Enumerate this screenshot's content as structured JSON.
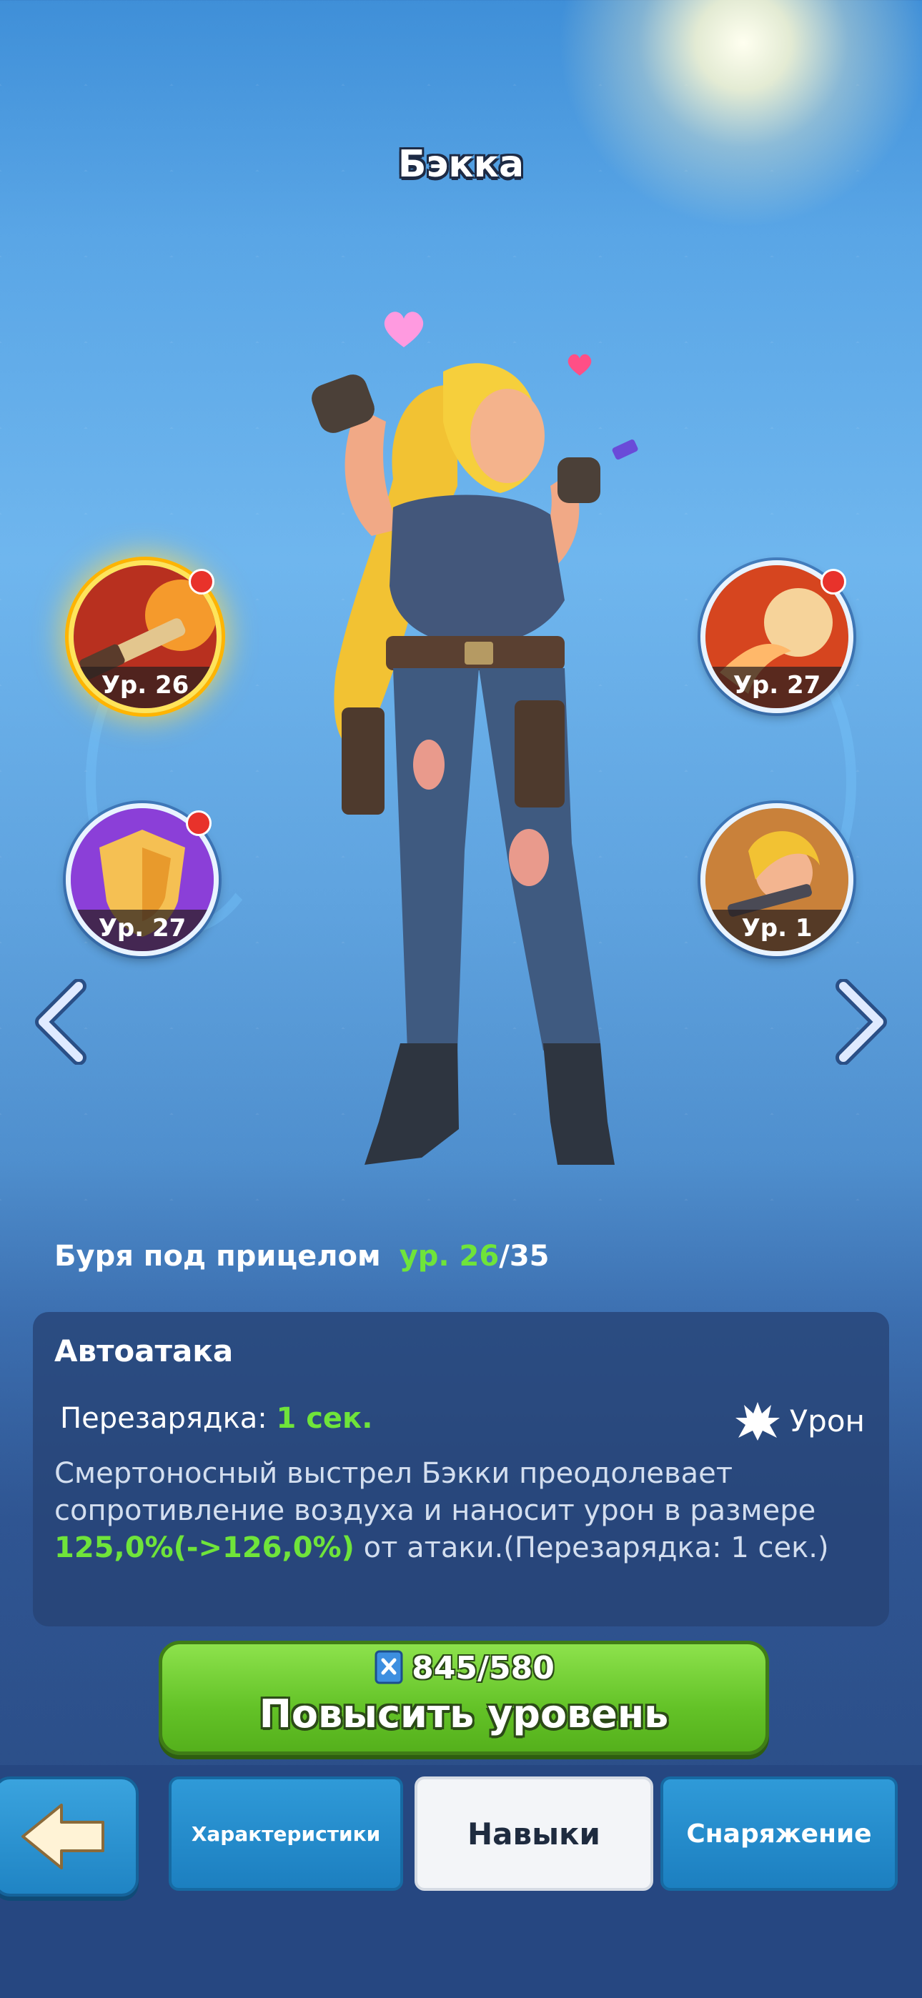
{
  "hero": {
    "name": "Бэкка"
  },
  "skills": [
    {
      "level_label": "Ур. 26",
      "selected": true,
      "has_notification": true
    },
    {
      "level_label": "Ур. 27",
      "selected": false,
      "has_notification": true
    },
    {
      "level_label": "Ур. 27",
      "selected": false,
      "has_notification": true
    },
    {
      "level_label": "Ур. 1",
      "selected": false,
      "has_notification": false
    }
  ],
  "selected_skill": {
    "name": "Буря под прицелом",
    "level_prefix": "ур. ",
    "level": "26",
    "level_max": "/35",
    "type": "Автоатака",
    "cooldown_label": "Перезарядка: ",
    "cooldown_value": "1 сек.",
    "damage_label": "Урон",
    "desc_part1": "Смертоносный выстрел Бэкки преодолевает сопротивление воздуха и наносит урон в размере ",
    "desc_highlight": "125,0%(->126,0%)",
    "desc_part2": " от атаки.(Перезарядка: 1 сек.)"
  },
  "upgrade": {
    "cost": "845/580",
    "label": "Повысить уровень"
  },
  "tabs": {
    "stats": "Характеристики",
    "skills": "Навыки",
    "gear": "Снаряжение"
  },
  "colors": {
    "highlight": "#6fe43a",
    "accent": "#ffd43b"
  }
}
